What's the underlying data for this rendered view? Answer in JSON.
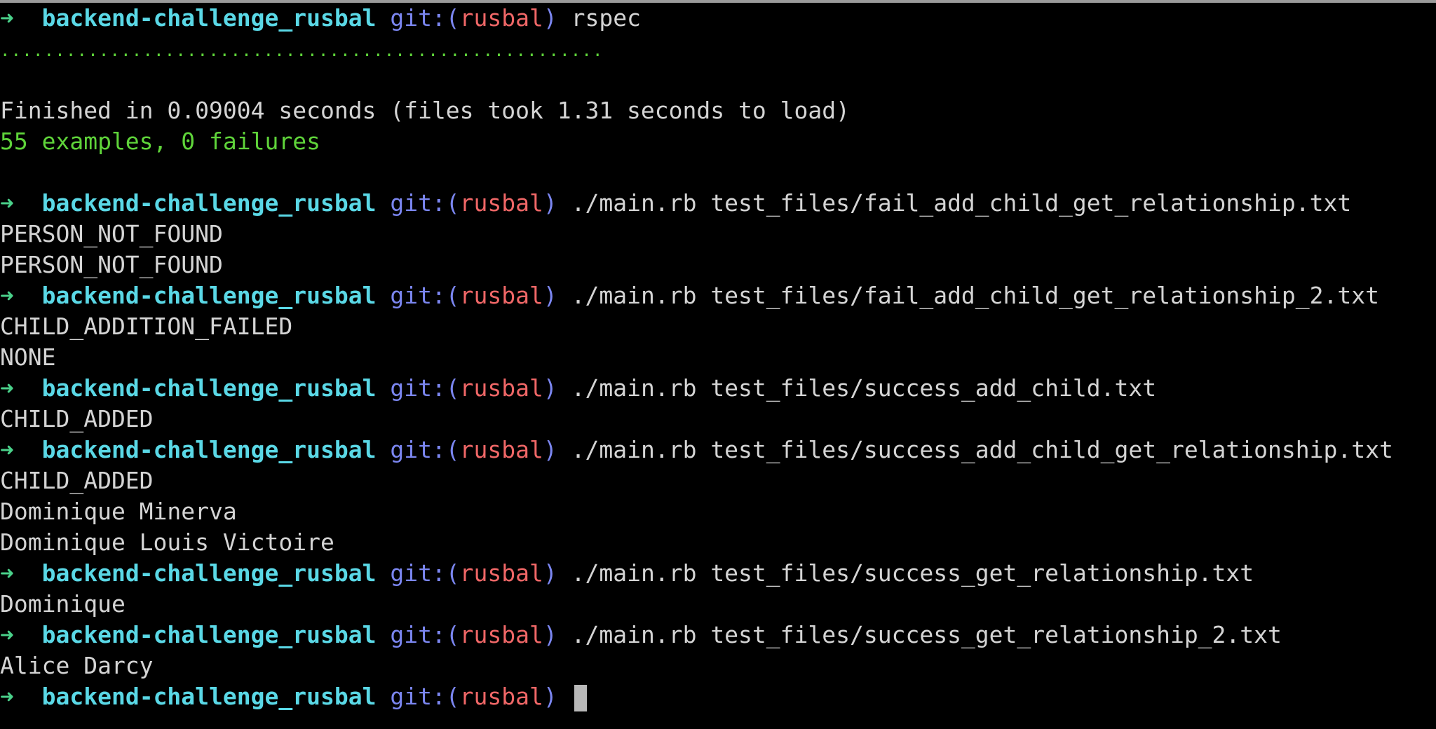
{
  "colors": {
    "background": "#000000",
    "text": "#d4d4d4",
    "arrow": "#4ad18a",
    "directory": "#5ad8e6",
    "git": "#7b86f0",
    "branch": "#f06767",
    "success": "#5fd43a",
    "cursor": "#b8b8b8"
  },
  "prompt": {
    "arrow": "➜",
    "directory": "backend-challenge_rusbal",
    "git_open": "git:(",
    "branch": "rusbal",
    "git_close": ")"
  },
  "rspec": {
    "command": "rspec",
    "dots": ".......................................................",
    "finished": "Finished in 0.09004 seconds (files took 1.31 seconds to load)",
    "summary": "55 examples, 0 failures"
  },
  "runs": [
    {
      "command": "./main.rb test_files/fail_add_child_get_relationship.txt",
      "output": [
        "PERSON_NOT_FOUND",
        "PERSON_NOT_FOUND"
      ]
    },
    {
      "command": "./main.rb test_files/fail_add_child_get_relationship_2.txt",
      "output": [
        "CHILD_ADDITION_FAILED",
        "NONE"
      ]
    },
    {
      "command": "./main.rb test_files/success_add_child.txt",
      "output": [
        "CHILD_ADDED"
      ]
    },
    {
      "command": "./main.rb test_files/success_add_child_get_relationship.txt",
      "output": [
        "CHILD_ADDED",
        "Dominique Minerva",
        "Dominique Louis Victoire"
      ]
    },
    {
      "command": "./main.rb test_files/success_get_relationship.txt",
      "output": [
        "Dominique"
      ]
    },
    {
      "command": "./main.rb test_files/success_get_relationship_2.txt",
      "output": [
        "Alice Darcy"
      ]
    }
  ]
}
